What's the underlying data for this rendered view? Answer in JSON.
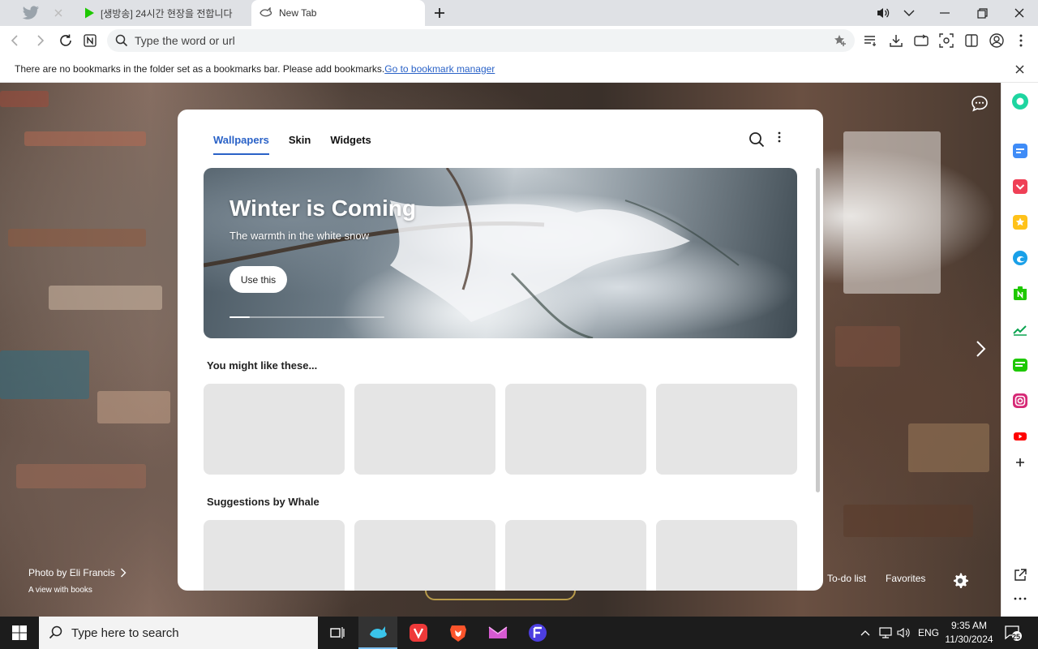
{
  "tabs": {
    "pinned_1_icon": "twitter-bird-icon",
    "pinned_2_icon": "close-icon",
    "background_tab_title": "[생방송] 24시간 현장을 전합니다",
    "active_tab_title": "New Tab"
  },
  "window_controls": [
    "speaker-icon",
    "chevron-down-icon",
    "minimize-icon",
    "restore-icon",
    "close-icon"
  ],
  "toolbar": {
    "omnibox_placeholder": "Type the word or url"
  },
  "bookmark_bar": {
    "message": "There are no bookmarks in the folder set as a bookmarks bar. Please add bookmarks.",
    "link": "Go to bookmark manager"
  },
  "panel": {
    "tabs": [
      "Wallpapers",
      "Skin",
      "Widgets"
    ],
    "active_tab": "Wallpapers",
    "hero": {
      "title": "Winter is Coming",
      "subtitle": "The warmth in the white snow",
      "button": "Use this",
      "progress": 0.13
    },
    "section_1_title": "You might like these...",
    "section_2_title": "Suggestions by Whale"
  },
  "background": {
    "photo_credit": "Photo by Eli Francis",
    "photo_description": "A view with books",
    "links": [
      "To-do list",
      "Favorites"
    ]
  },
  "sidebar": {
    "items": [
      "green-circle-icon",
      "calendar-icon",
      "pocket-icon",
      "star-icon",
      "edge-icon",
      "naver-icon",
      "stock-chart-icon",
      "papago-icon",
      "instagram-icon",
      "youtube-icon",
      "plus-icon"
    ],
    "bottom_items": [
      "external-link-icon",
      "more-icon"
    ]
  },
  "taskbar": {
    "search_placeholder": "Type here to search",
    "language": "ENG",
    "time": "9:35 AM",
    "date": "11/30/2024",
    "notification_count": "25"
  },
  "colors": {
    "accent": "#2a62c7",
    "card_placeholder": "#e5e5e5"
  }
}
